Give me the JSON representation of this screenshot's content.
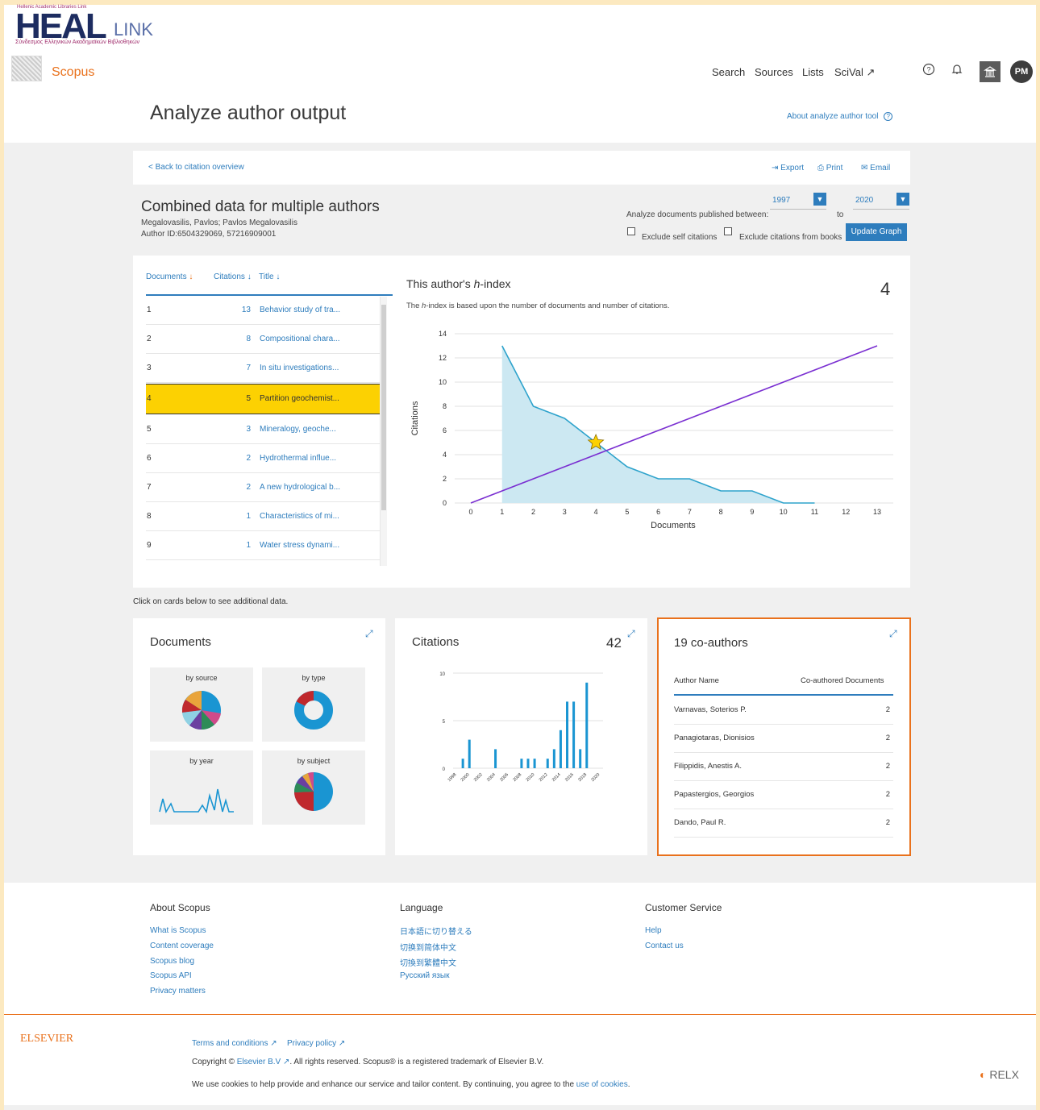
{
  "institution": {
    "small": "Hellenic Academic Libraries Link",
    "big": "HEAL",
    "link": "LINK",
    "sub": "Σύνδεσμος Ελληνικών Ακαδημαϊκών Βιβλιοθηκών"
  },
  "brand": "Scopus",
  "nav": [
    "Search",
    "Sources",
    "Lists",
    "SciVal ↗"
  ],
  "user_initials": "PM",
  "page_title": "Analyze author output",
  "about_link": "About analyze author tool",
  "back_link": "< Back to citation overview",
  "actions": {
    "export": "Export",
    "print": "Print",
    "email": "Email"
  },
  "author": {
    "heading": "Combined data for multiple authors",
    "names": "Megalovasilis, Pavlos; Pavlos Megalovasilis",
    "ids": "Author ID:6504329069, 57216909001"
  },
  "filter": {
    "label": "Analyze documents published between:",
    "from": "1997",
    "to_label": "to",
    "to": "2020",
    "exclude_self": "Exclude self citations",
    "exclude_books": "Exclude citations from books",
    "update_button": "Update Graph"
  },
  "doc_table": {
    "headers": {
      "documents": "Documents",
      "citations": "Citations",
      "title": "Title"
    },
    "rows": [
      {
        "n": "1",
        "c": "13",
        "t": "Behavior study of tra..."
      },
      {
        "n": "2",
        "c": "8",
        "t": "Compositional chara..."
      },
      {
        "n": "3",
        "c": "7",
        "t": "In situ investigations..."
      },
      {
        "n": "4",
        "c": "5",
        "t": "Partition geochemist..."
      },
      {
        "n": "5",
        "c": "3",
        "t": "Mineralogy, geoche..."
      },
      {
        "n": "6",
        "c": "2",
        "t": "Hydrothermal influe..."
      },
      {
        "n": "7",
        "c": "2",
        "t": "A new hydrological b..."
      },
      {
        "n": "8",
        "c": "1",
        "t": "Characteristics of mi..."
      },
      {
        "n": "9",
        "c": "1",
        "t": "Water stress dynami..."
      }
    ]
  },
  "hindex": {
    "title_pre": "This author's ",
    "title_em": "h",
    "title_post": "-index",
    "value": "4",
    "desc_pre": "The ",
    "desc_em": "h",
    "desc_post": "-index is based upon the number of documents and number of citations."
  },
  "chart_data": [
    {
      "type": "area",
      "title": "",
      "xlabel": "Documents",
      "ylabel": "Citations",
      "xlim": [
        0,
        13
      ],
      "ylim": [
        0,
        14
      ],
      "xticks": [
        0,
        1,
        2,
        3,
        4,
        5,
        6,
        7,
        8,
        9,
        10,
        11,
        12,
        13
      ],
      "yticks": [
        0,
        2,
        4,
        6,
        8,
        10,
        12,
        14
      ],
      "series": [
        {
          "x": [
            1,
            2,
            3,
            4,
            5,
            6,
            7,
            8,
            9,
            10,
            11
          ],
          "values": [
            13,
            8,
            7,
            5,
            3,
            2,
            2,
            1,
            1,
            0,
            0
          ]
        },
        {
          "x": [
            0,
            13
          ],
          "values": [
            0,
            13
          ]
        }
      ],
      "marker": {
        "x": 4,
        "y": 5
      },
      "colors": {
        "area": "#cce8f2",
        "line": "#2ea3cc",
        "diag": "#7a2fd1",
        "star": "#fcd102"
      }
    },
    {
      "type": "bar",
      "title": "",
      "ylim": [
        0,
        10
      ],
      "yticks": [
        0,
        5,
        10
      ],
      "categories": [
        "1998",
        "1999",
        "2000",
        "2001",
        "2002",
        "2003",
        "2004",
        "2005",
        "2006",
        "2007",
        "2008",
        "2009",
        "2010",
        "2011",
        "2012",
        "2013",
        "2014",
        "2015",
        "2016",
        "2017",
        "2018",
        "2019",
        "2020"
      ],
      "xtick_labels": [
        "1998",
        "2000",
        "2002",
        "2004",
        "2006",
        "2008",
        "2010",
        "2012",
        "2014",
        "2016",
        "2018",
        "2020"
      ],
      "values": [
        0,
        1,
        3,
        0,
        0,
        0,
        2,
        0,
        0,
        0,
        1,
        1,
        1,
        0,
        1,
        2,
        4,
        7,
        7,
        2,
        9,
        0,
        0
      ]
    }
  ],
  "click_hint": "Click on cards below to see additional data.",
  "cards": {
    "documents": {
      "title": "Documents",
      "by_source": "by source",
      "by_type": "by type",
      "by_year": "by year",
      "by_subject": "by subject"
    },
    "citations": {
      "title": "Citations",
      "count": "42"
    },
    "coauthors": {
      "title": "19 co-authors",
      "col1": "Author Name",
      "col2": "Co-authored Documents",
      "rows": [
        {
          "name": "Varnavas, Soterios P.",
          "count": "2"
        },
        {
          "name": "Panagiotaras, Dionisios",
          "count": "2"
        },
        {
          "name": "Filippidis, Anestis A.",
          "count": "2"
        },
        {
          "name": "Papastergios, Georgios",
          "count": "2"
        },
        {
          "name": "Dando, Paul R.",
          "count": "2"
        }
      ]
    }
  },
  "footer": {
    "about": {
      "title": "About Scopus",
      "links": [
        "What is Scopus",
        "Content coverage",
        "Scopus blog",
        "Scopus API",
        "Privacy matters"
      ]
    },
    "language": {
      "title": "Language",
      "links": [
        "日本語に切り替える",
        "切换到简体中文",
        "切換到繁體中文",
        "Русский язык"
      ]
    },
    "service": {
      "title": "Customer Service",
      "links": [
        "Help",
        "Contact us"
      ]
    }
  },
  "bottom": {
    "elsevier": "ELSEVIER",
    "terms": "Terms and conditions ↗",
    "privacy": "Privacy policy ↗",
    "copyright_pre": "Copyright © ",
    "copyright_link": "Elsevier B.V ↗",
    "copyright_post": ". All rights reserved. Scopus® is a registered trademark of Elsevier B.V.",
    "cookies_pre": "We use cookies to help provide and enhance our service and tailor content. By continuing, you agree to the ",
    "cookies_link": "use of cookies",
    "cookies_post": ".",
    "relx": "RELX"
  },
  "colors": {
    "accent": "#2e7dbd",
    "scopus_orange": "#e9711c",
    "highlight": "#fcd102"
  }
}
